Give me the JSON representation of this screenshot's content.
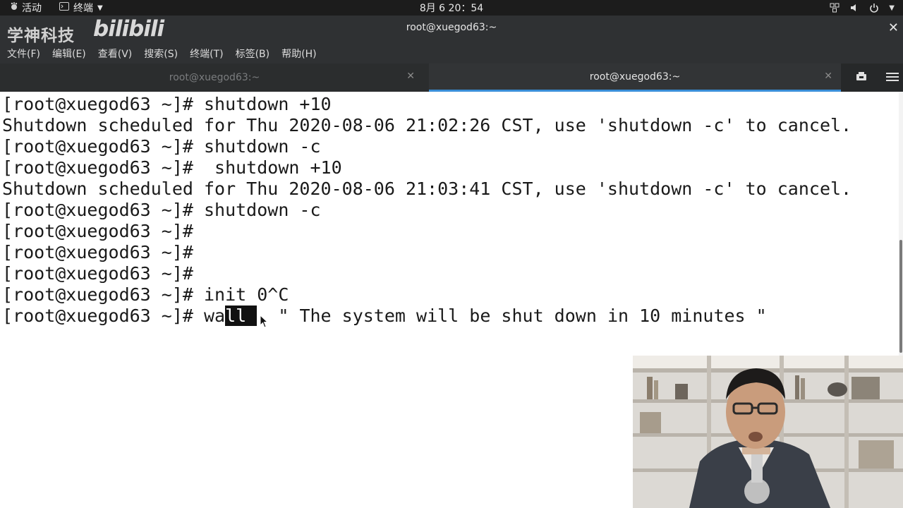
{
  "topbar": {
    "activities": "活动",
    "app_menu": "终端",
    "clock": "8月 6  20：54",
    "icons": [
      "network-icon",
      "volume-icon",
      "power-icon",
      "chevron-down-icon"
    ]
  },
  "window": {
    "logo_text": "学神科技",
    "bilibili": "bilibili",
    "title": "root@xuegod63:~"
  },
  "menu": [
    "文件(F)",
    "编辑(E)",
    "查看(V)",
    "搜索(S)",
    "终端(T)",
    "标签(B)",
    "帮助(H)"
  ],
  "tabs": [
    {
      "label": "root@xuegod63:~",
      "active": false
    },
    {
      "label": "root@xuegod63:~",
      "active": true
    }
  ],
  "terminal": {
    "lines": [
      "[root@xuegod63 ~]# shutdown +10",
      "Shutdown scheduled for Thu 2020-08-06 21:02:26 CST, use 'shutdown -c' to cancel.",
      "[root@xuegod63 ~]# shutdown -c",
      "[root@xuegod63 ~]#  shutdown +10",
      "Shutdown scheduled for Thu 2020-08-06 21:03:41 CST, use 'shutdown -c' to cancel.",
      "[root@xuegod63 ~]# shutdown -c",
      "[root@xuegod63 ~]#",
      "[root@xuegod63 ~]#",
      "[root@xuegod63 ~]#",
      "[root@xuegod63 ~]# init 0^C"
    ],
    "last": {
      "prompt": "[root@xuegod63 ~]# ",
      "cmd_a": "wa",
      "cmd_selected": "ll ",
      "rest": "  \" The system will be shut down in 10 minutes \""
    }
  },
  "colors": {
    "topbar": "#1c1c1c",
    "chrome": "#2f3133",
    "tab_accent": "#3a8fd8",
    "terminal_bg": "#ffffff",
    "terminal_fg": "#1a1a1a"
  }
}
